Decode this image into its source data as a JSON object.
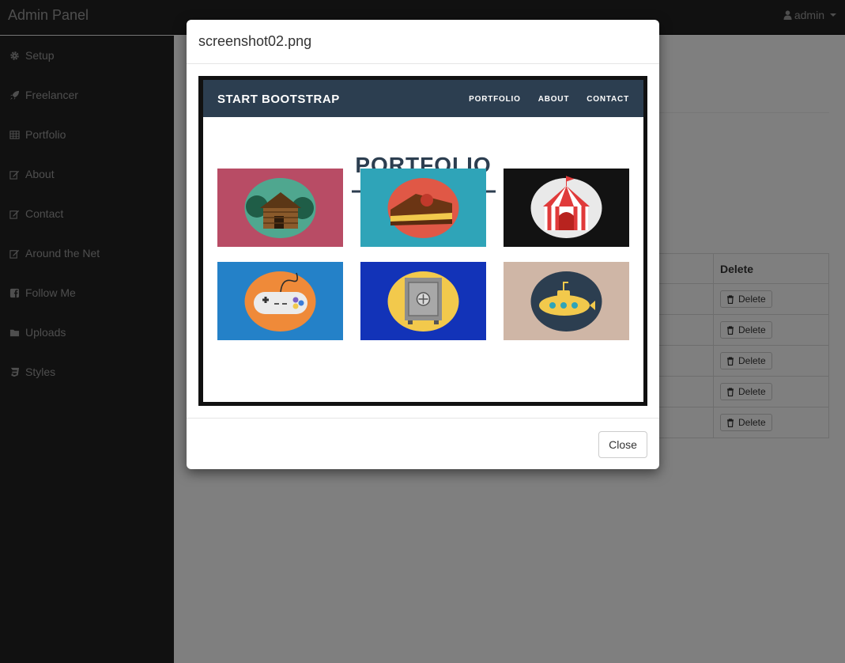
{
  "navbar": {
    "brand": "Admin Panel",
    "user": "admin"
  },
  "sidebar": {
    "items": [
      {
        "label": "Setup",
        "icon": "cog-icon"
      },
      {
        "label": "Freelancer",
        "icon": "rocket-icon"
      },
      {
        "label": "Portfolio",
        "icon": "table-icon"
      },
      {
        "label": "About",
        "icon": "edit-icon"
      },
      {
        "label": "Contact",
        "icon": "edit-icon"
      },
      {
        "label": "Around the Net",
        "icon": "edit-icon"
      },
      {
        "label": "Follow Me",
        "icon": "facebook-icon"
      },
      {
        "label": "Uploads",
        "icon": "folder-icon"
      },
      {
        "label": "Styles",
        "icon": "css3-icon"
      }
    ]
  },
  "table": {
    "delete_header": "Delete",
    "rows": [
      {
        "delete_label": "Delete"
      },
      {
        "delete_label": "Delete"
      },
      {
        "delete_label": "Delete"
      },
      {
        "delete_label": "Delete"
      },
      {
        "delete_label": "Delete"
      }
    ]
  },
  "modal": {
    "title": "screenshot02.png",
    "close_label": "Close",
    "preview": {
      "brand": "START BOOTSTRAP",
      "nav_links": [
        "PORTFOLIO",
        "ABOUT",
        "CONTACT"
      ],
      "heading": "PORTFOLIO",
      "tiles": [
        {
          "name": "cabin",
          "bg": "#b84c65"
        },
        {
          "name": "cake",
          "bg": "#2fa4b8"
        },
        {
          "name": "circus",
          "bg": "#121212"
        },
        {
          "name": "game-controller",
          "bg": "#2481c8"
        },
        {
          "name": "safe",
          "bg": "#1233b8"
        },
        {
          "name": "submarine",
          "bg": "#cfb6a6"
        }
      ]
    }
  },
  "colors": {
    "navbar_bg": "#222222",
    "preview_nav_bg": "#2c3e50",
    "backdrop": "rgba(0,0,0,0.5)"
  }
}
